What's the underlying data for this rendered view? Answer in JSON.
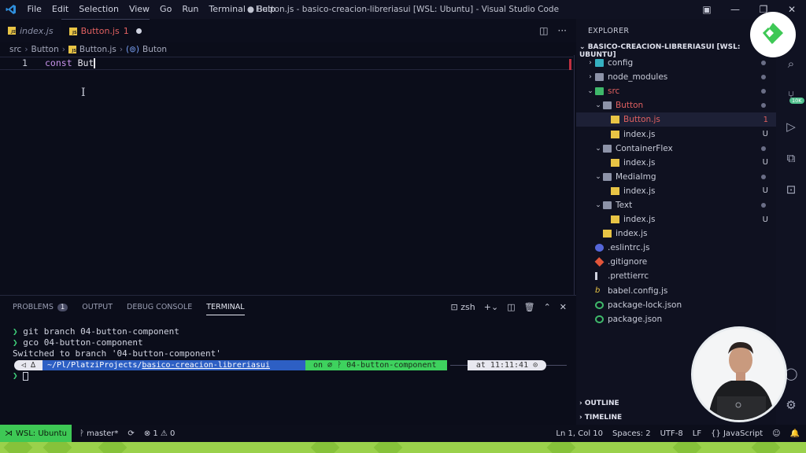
{
  "titlebar": {
    "menu": [
      "File",
      "Edit",
      "Selection",
      "View",
      "Go",
      "Run",
      "Terminal",
      "Help"
    ],
    "title": "● Button.js - basico-creacion-libreriasui [WSL: Ubuntu] - Visual Studio Code"
  },
  "tabs": [
    {
      "label": "index.js",
      "active": false
    },
    {
      "label": "Button.js",
      "problems": "1",
      "active": true
    }
  ],
  "breadcrumb": [
    "src",
    "Button",
    "Button.js",
    "Buton"
  ],
  "editor": {
    "line_number": "1",
    "keyword": "const",
    "identifier": "But"
  },
  "panel": {
    "tabs": [
      "PROBLEMS",
      "OUTPUT",
      "DEBUG CONSOLE",
      "TERMINAL"
    ],
    "problems_count": "1",
    "active_tab": "TERMINAL",
    "shell_label": "zsh",
    "terminal_lines": [
      {
        "prompt": "❯",
        "text": "git branch 04-button-component"
      },
      {
        "prompt": "❯",
        "text": "gco 04-button-component"
      },
      {
        "prompt": "",
        "text": "Switched to branch '04-button-component'"
      }
    ],
    "prompt_bar": {
      "path_prefix": "~/Pl/PlatziProjects/",
      "path_dir": "basico-creacion-libreriasui",
      "git": "on ⌀ ᚹ 04-button-component",
      "time": "at 11:11:41 ⊙"
    },
    "input_prompt": "❯"
  },
  "explorer": {
    "title": "EXPLORER",
    "root": "BASICO-CREACION-LIBRERIASUI [WSL: UBUNTU]",
    "items": [
      {
        "name": "config",
        "depth": 1,
        "type": "folder",
        "color": "teal",
        "twisty": "›",
        "dot": true
      },
      {
        "name": "node_modules",
        "depth": 1,
        "type": "folder",
        "color": "gray",
        "twisty": "›",
        "dot": true
      },
      {
        "name": "src",
        "depth": 1,
        "type": "folder",
        "color": "green",
        "twisty": "⌄",
        "dot": true,
        "red": true
      },
      {
        "name": "Button",
        "depth": 2,
        "type": "folder",
        "color": "gray",
        "twisty": "⌄",
        "dot": true,
        "red": true
      },
      {
        "name": "Button.js",
        "depth": 3,
        "type": "js",
        "status": "1",
        "red": true,
        "selected": true
      },
      {
        "name": "index.js",
        "depth": 3,
        "type": "js",
        "status": "U"
      },
      {
        "name": "ContainerFlex",
        "depth": 2,
        "type": "folder",
        "color": "gray",
        "twisty": "⌄",
        "dot": true
      },
      {
        "name": "index.js",
        "depth": 3,
        "type": "js",
        "status": "U"
      },
      {
        "name": "MediaImg",
        "depth": 2,
        "type": "folder",
        "color": "gray",
        "twisty": "⌄",
        "dot": true
      },
      {
        "name": "index.js",
        "depth": 3,
        "type": "js",
        "status": "U"
      },
      {
        "name": "Text",
        "depth": 2,
        "type": "folder",
        "color": "gray",
        "twisty": "⌄",
        "dot": true
      },
      {
        "name": "index.js",
        "depth": 3,
        "type": "js",
        "status": "U"
      },
      {
        "name": "index.js",
        "depth": 2,
        "type": "js"
      },
      {
        "name": ".eslintrc.js",
        "depth": 1,
        "type": "eslint"
      },
      {
        "name": ".gitignore",
        "depth": 1,
        "type": "git"
      },
      {
        "name": ".prettierrc",
        "depth": 1,
        "type": "prettier"
      },
      {
        "name": "babel.config.js",
        "depth": 1,
        "type": "babel"
      },
      {
        "name": "package-lock.json",
        "depth": 1,
        "type": "json"
      },
      {
        "name": "package.json",
        "depth": 1,
        "type": "json"
      }
    ],
    "outline": "OUTLINE",
    "timeline": "TIMELINE"
  },
  "activity": {
    "scm_badge": "10K"
  },
  "statusbar": {
    "remote": "WSL: Ubuntu",
    "branch": "master*",
    "problems": "⊗ 1 ⚠ 0",
    "position": "Ln 1, Col 10",
    "spaces": "Spaces: 2",
    "encoding": "UTF-8",
    "eol": "LF",
    "language": "{} JavaScript"
  },
  "colors": {
    "accent_green": "#3ec855",
    "error_red": "#e06060",
    "background": "#0b0d1a"
  }
}
